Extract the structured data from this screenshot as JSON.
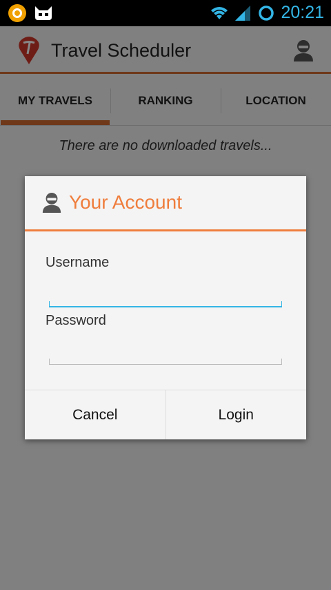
{
  "status_bar": {
    "time": "20:21",
    "icons": [
      "app-notification-icon",
      "cyanogen-icon",
      "wifi-icon",
      "signal-icon",
      "sync-ring-icon"
    ]
  },
  "action_bar": {
    "title": "Travel Scheduler",
    "logo_icon": "travel-scheduler-logo",
    "profile_icon": "user-profile-icon"
  },
  "tabs": [
    {
      "label": "MY TRAVELS",
      "active": true
    },
    {
      "label": "RANKING",
      "active": false
    },
    {
      "label": "LOCATION",
      "active": false
    }
  ],
  "main": {
    "empty_message": "There are no downloaded travels..."
  },
  "dialog": {
    "title": "Your Account",
    "icon": "user-account-icon",
    "username_label": "Username",
    "username_value": "",
    "password_label": "Password",
    "password_value": "",
    "cancel_label": "Cancel",
    "login_label": "Login"
  },
  "colors": {
    "accent": "#ef7d3c",
    "tab_indicator": "#d06a30",
    "focus": "#33b5e5"
  }
}
